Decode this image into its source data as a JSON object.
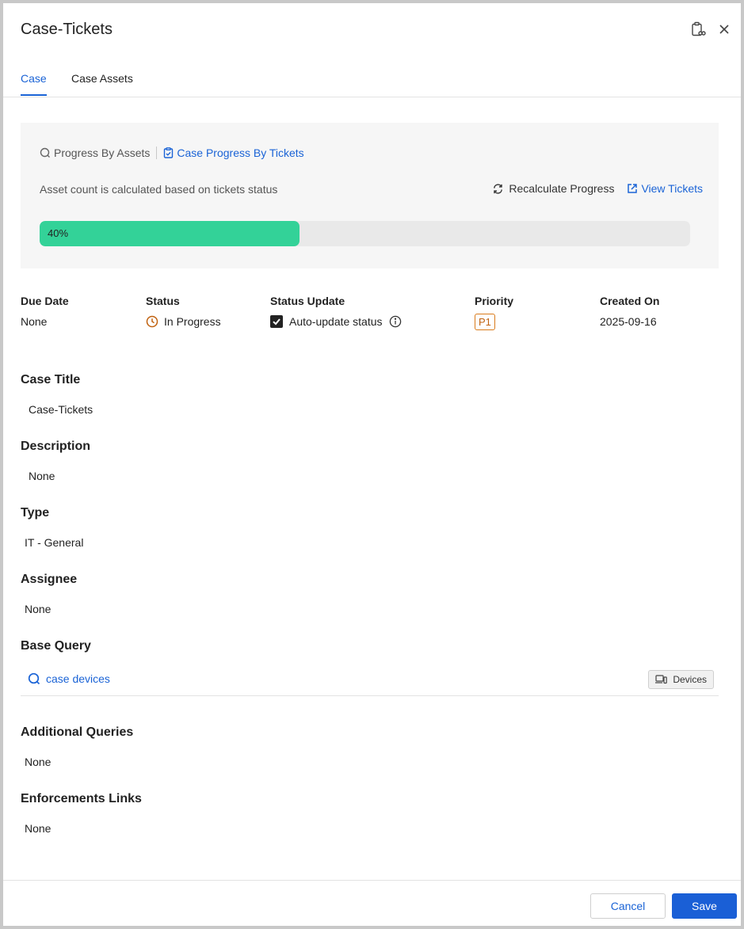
{
  "header": {
    "title": "Case-Tickets",
    "icons": [
      "clipboard-link-icon",
      "close-icon"
    ]
  },
  "tabs": [
    {
      "label": "Case",
      "active": true
    },
    {
      "label": "Case Assets",
      "active": false
    }
  ],
  "progress": {
    "by_assets_label": "Progress By Assets",
    "by_tickets_label": "Case Progress By Tickets",
    "description": "Asset count is calculated based on tickets status",
    "recalculate_label": "Recalculate Progress",
    "view_tickets_label": "View Tickets",
    "percent": 40,
    "percent_label": "40%",
    "bar_color": "#33d298"
  },
  "meta": {
    "due_date": {
      "label": "Due Date",
      "value": "None"
    },
    "status": {
      "label": "Status",
      "value": "In Progress",
      "icon": "clock-icon",
      "color": "#c0610f"
    },
    "status_update": {
      "label": "Status Update",
      "value": "Auto-update status",
      "checked": true,
      "icon": "info-icon"
    },
    "priority": {
      "label": "Priority",
      "value": "P1",
      "color": "#d97a1a"
    },
    "created_on": {
      "label": "Created On",
      "value": "2025-09-16"
    }
  },
  "sections": {
    "case_title": {
      "label": "Case Title",
      "value": "Case-Tickets"
    },
    "description": {
      "label": "Description",
      "value": "None"
    },
    "type": {
      "label": "Type",
      "value": "IT - General"
    },
    "assignee": {
      "label": "Assignee",
      "value": "None"
    },
    "base_query": {
      "label": "Base Query",
      "query_name": "case devices",
      "chip_label": "Devices",
      "icon": "devices-icon"
    },
    "additional_queries": {
      "label": "Additional Queries",
      "value": "None"
    },
    "enforcements_links": {
      "label": "Enforcements Links",
      "value": "None"
    }
  },
  "footer": {
    "cancel_label": "Cancel",
    "save_label": "Save"
  },
  "colors": {
    "accent": "#1a63d6",
    "primary_button": "#1a5fd6"
  }
}
